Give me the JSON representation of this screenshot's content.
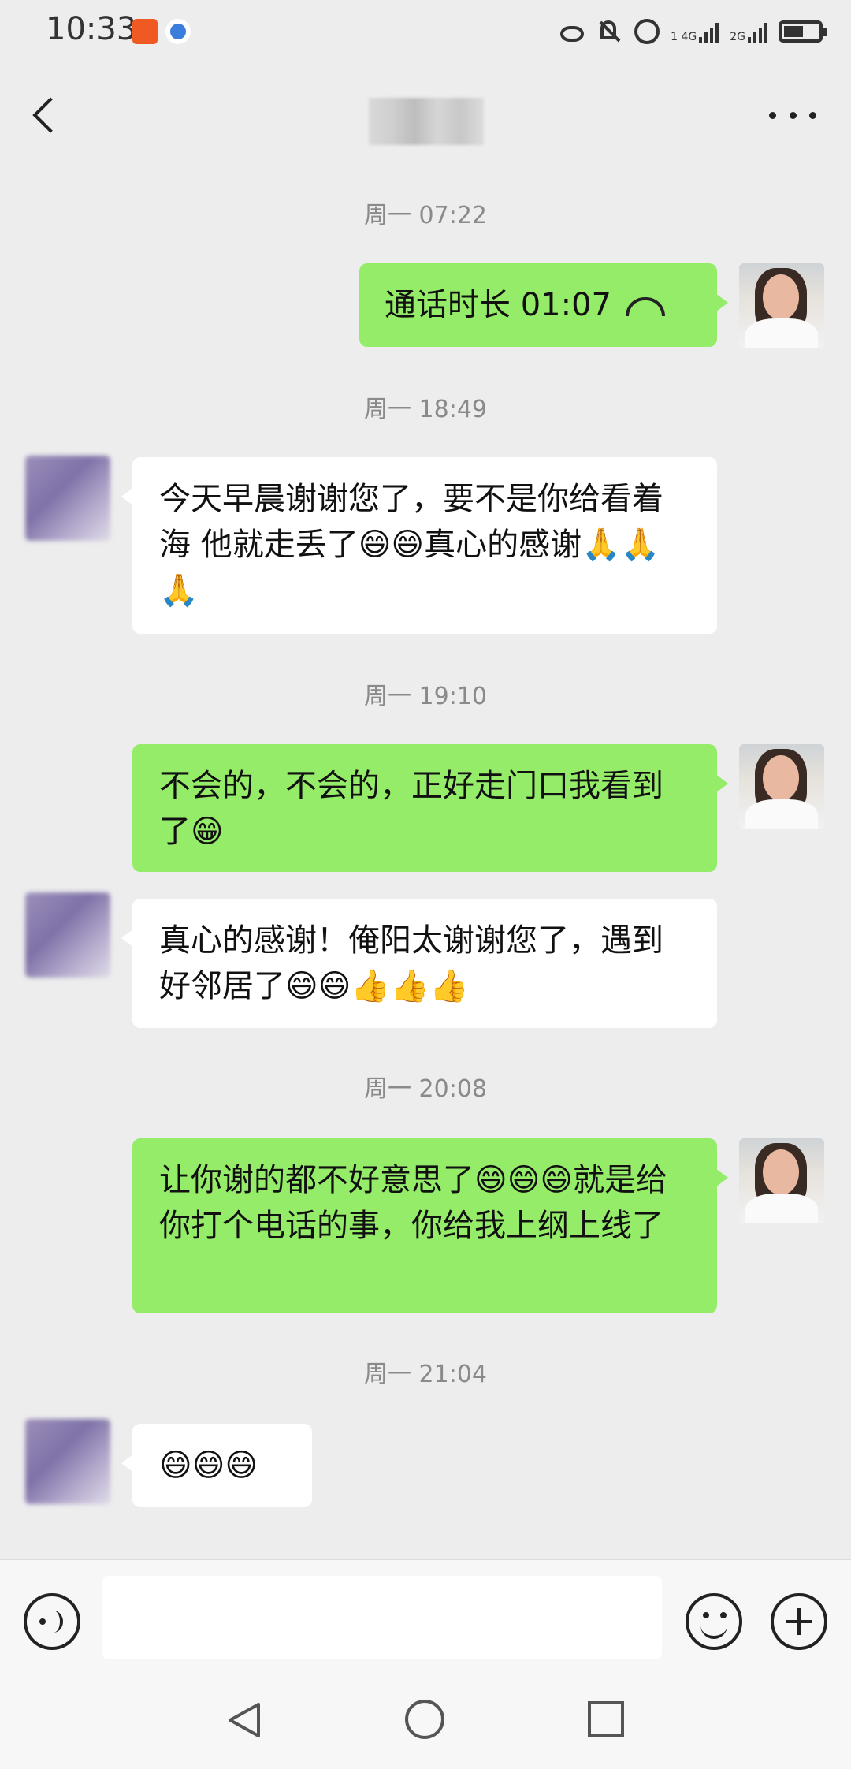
{
  "status_bar": {
    "time": "10:33",
    "sim1_label": "1 4G",
    "sim2_label": "2G"
  },
  "header": {
    "contact_name": ""
  },
  "messages": [
    {
      "type": "timestamp",
      "text": "周一 07:22"
    },
    {
      "type": "call",
      "sender": "me",
      "text": "通话时长 01:07"
    },
    {
      "type": "timestamp",
      "text": "周一 18:49"
    },
    {
      "type": "text",
      "sender": "other",
      "text": "今天早晨谢谢您了，要不是你给看着海   他就走丢了😄😄真心的感谢🙏🙏🙏"
    },
    {
      "type": "timestamp",
      "text": "周一 19:10"
    },
    {
      "type": "text",
      "sender": "me",
      "text": "不会的，不会的，正好走门口我看到了😁"
    },
    {
      "type": "text",
      "sender": "other",
      "text": "真心的感谢！俺阳太谢谢您了，遇到好邻居了😄😄👍👍👍"
    },
    {
      "type": "timestamp",
      "text": "周一 20:08"
    },
    {
      "type": "text",
      "sender": "me",
      "text": "让你谢的都不好意思了😄😄😄就是给你打个电话的事，你给我上纲上线了"
    },
    {
      "type": "timestamp",
      "text": "周一 21:04"
    },
    {
      "type": "text",
      "sender": "other",
      "text": "😄😄😄"
    }
  ],
  "input_bar": {
    "placeholder": ""
  },
  "colors": {
    "my_bubble": "#95ec69",
    "other_bubble": "#ffffff",
    "background": "#ededed"
  }
}
